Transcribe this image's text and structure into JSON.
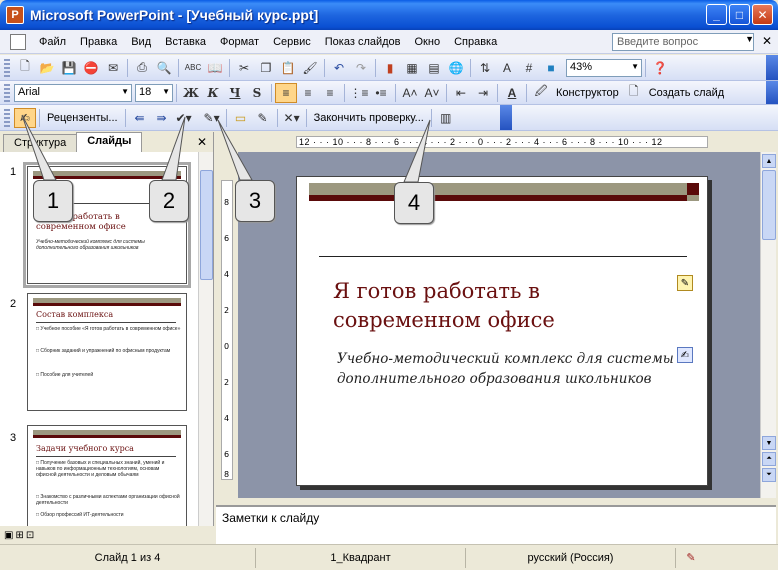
{
  "window": {
    "title": "Microsoft PowerPoint - [Учебный курс.ppt]",
    "app_icon": "powerpoint-icon",
    "buttons": {
      "minimize": "_",
      "maximize": "□",
      "close": "✕"
    }
  },
  "menubar": {
    "items": [
      "Файл",
      "Правка",
      "Вид",
      "Вставка",
      "Формат",
      "Сервис",
      "Показ слайдов",
      "Окно",
      "Справка"
    ],
    "help_placeholder": "Введите вопрос",
    "close": "✕"
  },
  "standard_toolbar": {
    "zoom": "43%",
    "icons": [
      "new-icon",
      "open-icon",
      "save-icon",
      "permission-icon",
      "email-icon",
      "print-icon",
      "print-preview-icon",
      "spelling-icon",
      "research-icon",
      "cut-icon",
      "copy-icon",
      "paste-icon",
      "format-painter-icon",
      "undo-icon",
      "redo-icon",
      "chart-icon",
      "table-icon",
      "tables-borders-icon",
      "hyperlink-icon",
      "expand-icon",
      "show-formatting-icon",
      "grid-icon",
      "color-grayscale-icon",
      "help-icon"
    ]
  },
  "formatting_toolbar": {
    "font": "Arial",
    "size": "18",
    "bold": "Ж",
    "italic": "К",
    "underline": "Ч",
    "shadow": "S",
    "design_label": "Конструктор",
    "new_slide_label": "Создать слайд"
  },
  "review_toolbar": {
    "reviewers_label": "Рецензенты...",
    "end_review_label": "Закончить проверку..."
  },
  "left_pane": {
    "tabs": [
      "Структура",
      "Слайды"
    ],
    "active_tab": "Слайды",
    "close": "✕",
    "slides": [
      {
        "number": "1",
        "title": "Я готов работать в современном офисе",
        "bullets": [
          "Учебно-методический комплекс для системы дополнительного образования школьников"
        ]
      },
      {
        "number": "2",
        "title": "Состав комплекса",
        "bullets": [
          "Учебное пособие «Я готов работать в современном офисе»",
          "Сборник заданий и упражнений по офисным продуктам",
          "Пособие для учителей"
        ]
      },
      {
        "number": "3",
        "title": "Задачи учебного курса",
        "bullets": [
          "Получение базовых и специальных знаний, умений и навыков по информационным технологиям, основам офисной деятельности и деловым обычаям",
          "Знакомство с различными аспектами организации офисной деятельности",
          "Обзор профессий ИТ-деятельности"
        ]
      }
    ]
  },
  "ruler": {
    "horizontal": "12 · · · 10 · · · 8 · · · 6 · · · 4 · · · 2 · · · 0 · · · 2 · · · 4 · · · 6 · · · 8 · · · 10 · · · 12",
    "vertical": [
      "8",
      "6",
      "4",
      "2",
      "0",
      "2",
      "4",
      "6",
      "8"
    ]
  },
  "slide": {
    "title": "Я готов работать в современном офисе",
    "subtitle": "Учебно-методический комплекс для системы дополнительного образования школьников"
  },
  "notes": {
    "placeholder": "Заметки к слайду"
  },
  "status": {
    "slide": "Слайд 1 из 4",
    "design": "1_Квадрант",
    "language": "русский (Россия)"
  },
  "callouts": [
    "1",
    "2",
    "3",
    "4"
  ],
  "colors": {
    "title_bar": "#0A5CE5",
    "slide_title": "#6A1010",
    "band_gray": "#9C9880",
    "band_red": "#5A0A0A",
    "stage": "#8C94A8"
  }
}
